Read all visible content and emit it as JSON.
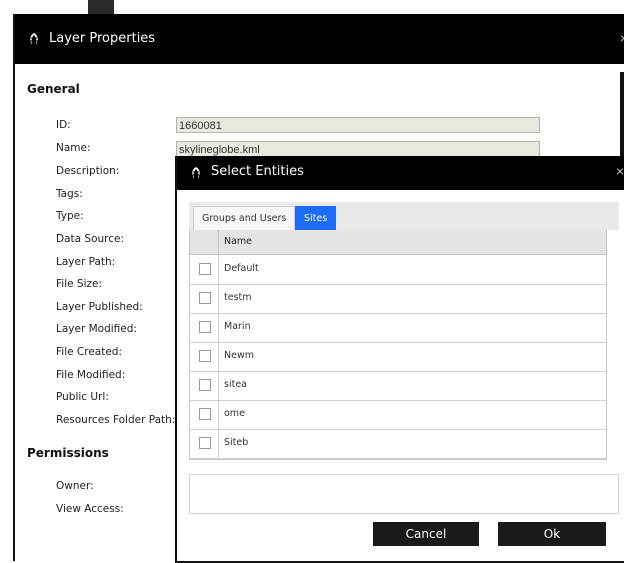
{
  "layer_properties": {
    "title": "Layer Properties",
    "close_glyph": "×",
    "general": {
      "title": "General",
      "fields": [
        {
          "label": "ID:",
          "value": "1660081"
        },
        {
          "label": "Name:",
          "value": "skylineglobe.kml"
        },
        {
          "label": "Description:"
        },
        {
          "label": "Tags:"
        },
        {
          "label": "Type:"
        },
        {
          "label": "Data Source:"
        },
        {
          "label": "Layer Path:"
        },
        {
          "label": "File Size:"
        },
        {
          "label": "Layer Published:"
        },
        {
          "label": "Layer Modified:"
        },
        {
          "label": "File Created:"
        },
        {
          "label": "File Modified:"
        },
        {
          "label": "Public Url:"
        },
        {
          "label": "Resources Folder Path:"
        }
      ]
    },
    "permissions": {
      "title": "Permissions",
      "fields": [
        {
          "label": "Owner:"
        },
        {
          "label": "View Access:"
        }
      ]
    }
  },
  "select_entities": {
    "title": "Select Entities",
    "close_glyph": "×",
    "tabs": [
      {
        "label": "Groups and Users",
        "active": false
      },
      {
        "label": "Sites",
        "active": true
      }
    ],
    "grid": {
      "column": "Name",
      "rows": [
        "Default",
        "testm",
        "Marin",
        "Newm",
        "sitea",
        "ome",
        "Siteb"
      ]
    },
    "buttons": {
      "cancel": "Cancel",
      "ok": "Ok"
    }
  },
  "colors": {
    "accent": "#1e6cf5",
    "titlebar": "#000000",
    "button": "#1a1a1a"
  },
  "icons": {
    "app_logo": "skyline-logo-icon",
    "close": "close-icon",
    "checkbox": "checkbox-icon"
  }
}
